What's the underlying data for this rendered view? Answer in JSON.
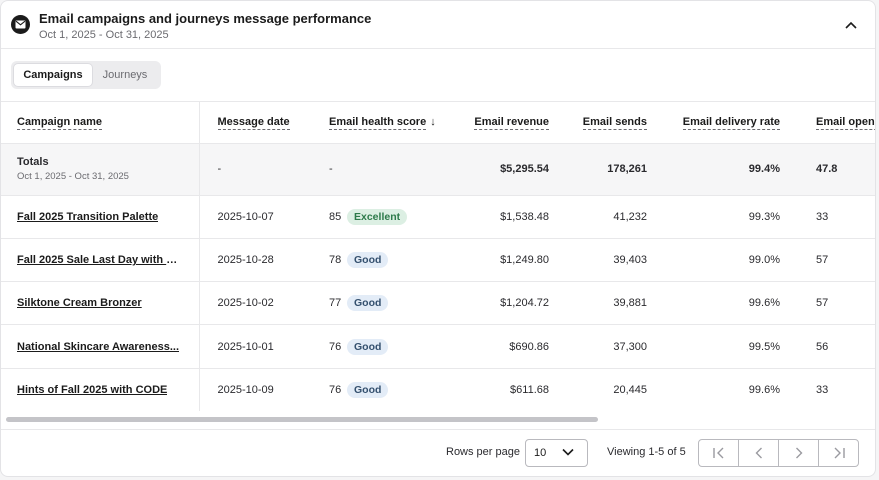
{
  "header": {
    "title": "Email campaigns and journeys message performance",
    "date_range": "Oct 1, 2025 - Oct 31, 2025",
    "icon": "envelope-icon",
    "collapse_icon": "chevron-up-icon"
  },
  "tabs": [
    {
      "label": "Campaigns",
      "active": true
    },
    {
      "label": "Journeys",
      "active": false
    }
  ],
  "table": {
    "columns": [
      "Campaign name",
      "Message date",
      "Email health score",
      "Email revenue",
      "Email sends",
      "Email delivery rate",
      "Email open r"
    ],
    "sort_column": "Email health score",
    "sort_direction": "descending",
    "totals": {
      "label": "Totals",
      "range": "Oct 1, 2025 - Oct 31, 2025",
      "message_date": "-",
      "health_score": "-",
      "revenue": "$5,295.54",
      "sends": "178,261",
      "delivery_rate": "99.4%",
      "open_rate": "47.8"
    },
    "rows": [
      {
        "name": "Fall 2025 Transition Palette",
        "date": "2025-10-07",
        "score": "85",
        "badge": "Excellent",
        "revenue": "$1,538.48",
        "sends": "41,232",
        "delivery_rate": "99.3%",
        "open_rate": "33"
      },
      {
        "name": "Fall 2025 Sale Last Day with C...",
        "date": "2025-10-28",
        "score": "78",
        "badge": "Good",
        "revenue": "$1,249.80",
        "sends": "39,403",
        "delivery_rate": "99.0%",
        "open_rate": "57"
      },
      {
        "name": "Silktone Cream Bronzer",
        "date": "2025-10-02",
        "score": "77",
        "badge": "Good",
        "revenue": "$1,204.72",
        "sends": "39,881",
        "delivery_rate": "99.6%",
        "open_rate": "57"
      },
      {
        "name": "National Skincare Awareness...",
        "date": "2025-10-01",
        "score": "76",
        "badge": "Good",
        "revenue": "$690.86",
        "sends": "37,300",
        "delivery_rate": "99.5%",
        "open_rate": "56"
      },
      {
        "name": "Hints of Fall 2025 with CODE",
        "date": "2025-10-09",
        "score": "76",
        "badge": "Good",
        "revenue": "$611.68",
        "sends": "20,445",
        "delivery_rate": "99.6%",
        "open_rate": "33"
      }
    ]
  },
  "pagination": {
    "rows_per_page_label": "Rows per page",
    "rows_per_page_value": "10",
    "viewing_text": "Viewing 1-5 of 5",
    "buttons": [
      "first-page-icon",
      "previous-page-icon",
      "next-page-icon",
      "last-page-icon"
    ]
  },
  "colors": {
    "excellent_bg": "#dcefe3",
    "excellent_text": "#2d7a4a",
    "good_bg": "#e3ecf7",
    "good_text": "#34506e"
  }
}
